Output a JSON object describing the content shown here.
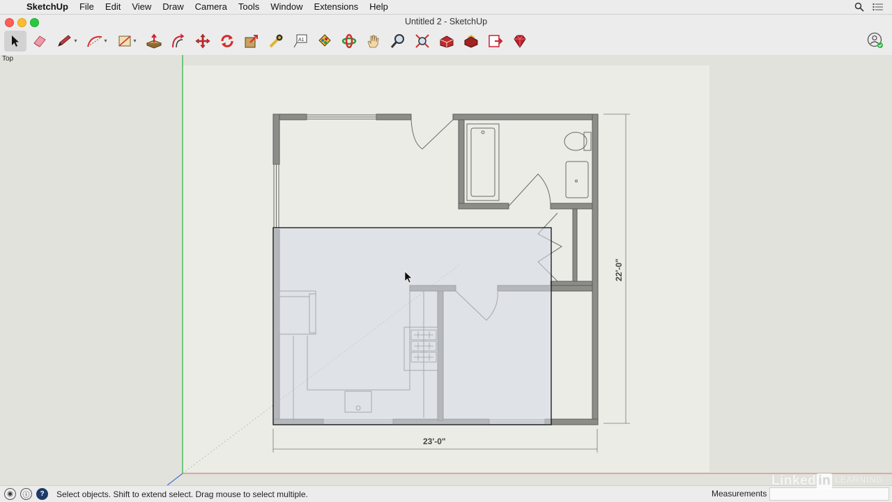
{
  "menubar": {
    "app_name": "SketchUp",
    "items": [
      "File",
      "Edit",
      "View",
      "Draw",
      "Camera",
      "Tools",
      "Window",
      "Extensions",
      "Help"
    ]
  },
  "window": {
    "title": "Untitled 2 - SketchUp"
  },
  "toolbar": {
    "tools": [
      {
        "name": "select-tool",
        "icon": "arrow-cursor-icon",
        "active": true
      },
      {
        "name": "eraser-tool",
        "icon": "eraser-icon"
      },
      {
        "name": "line-tool",
        "icon": "pencil-icon",
        "dropdown": true
      },
      {
        "name": "arc-tool",
        "icon": "arc-icon",
        "dropdown": true
      },
      {
        "name": "rectangle-tool",
        "icon": "rectangle-icon",
        "dropdown": true
      },
      {
        "name": "push-pull-tool",
        "icon": "push-pull-icon"
      },
      {
        "name": "offset-tool",
        "icon": "offset-icon"
      },
      {
        "name": "move-tool",
        "icon": "move-icon"
      },
      {
        "name": "rotate-tool",
        "icon": "rotate-icon"
      },
      {
        "name": "scale-tool",
        "icon": "scale-icon"
      },
      {
        "name": "tape-measure-tool",
        "icon": "tape-measure-icon"
      },
      {
        "name": "text-tool",
        "icon": "text-icon"
      },
      {
        "name": "paint-bucket-tool",
        "icon": "paint-bucket-icon"
      },
      {
        "name": "orbit-tool",
        "icon": "orbit-icon"
      },
      {
        "name": "pan-tool",
        "icon": "hand-icon"
      },
      {
        "name": "zoom-tool",
        "icon": "magnifier-icon"
      },
      {
        "name": "zoom-extents-tool",
        "icon": "zoom-extents-icon"
      },
      {
        "name": "3d-warehouse",
        "icon": "warehouse-icon"
      },
      {
        "name": "extension-warehouse",
        "icon": "extension-warehouse-icon"
      },
      {
        "name": "layout-send",
        "icon": "layout-icon"
      },
      {
        "name": "extension-manager",
        "icon": "ruby-icon"
      }
    ]
  },
  "viewport": {
    "view_label": "Top",
    "dimensions": {
      "width_label": "23'-0\"",
      "height_label": "22'-0\""
    }
  },
  "statusbar": {
    "text": "Select objects. Shift to extend select. Drag mouse to select multiple.",
    "measurements_label": "Measurements",
    "measurements_value": ""
  },
  "watermark": {
    "brand": "Linked",
    "in": "in",
    "learning": "LEARNING"
  },
  "colors": {
    "wall_fill": "#8c8c88",
    "wall_stroke": "#5d5d5a",
    "selection_fill": "#d6dbe6",
    "green_axis": "#25b43a",
    "red_axis": "#e36a6a",
    "blue_axis": "#3f6fd8"
  }
}
